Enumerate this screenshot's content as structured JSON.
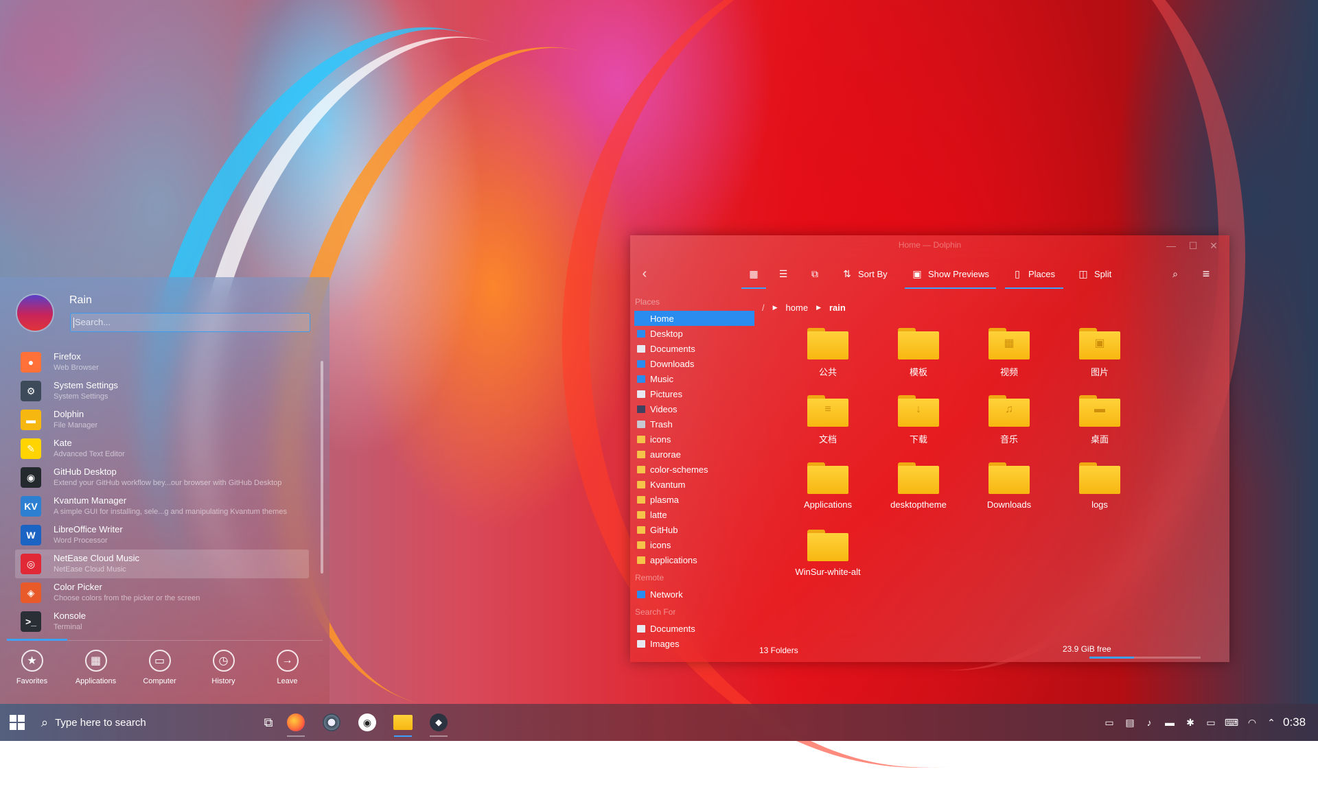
{
  "start_menu": {
    "username": "Rain",
    "search_placeholder": "Search...",
    "apps": [
      {
        "name": "Firefox",
        "desc": "Web Browser",
        "icon": "firefox-icon",
        "color": "#ff7139"
      },
      {
        "name": "System Settings",
        "desc": "System Settings",
        "icon": "settings-icon",
        "color": "#3c4a5a"
      },
      {
        "name": "Dolphin",
        "desc": "File Manager",
        "icon": "folder-icon",
        "color": "#f7b711"
      },
      {
        "name": "Kate",
        "desc": "Advanced Text Editor",
        "icon": "kate-icon",
        "color": "#ffd400"
      },
      {
        "name": "GitHub Desktop",
        "desc": "Extend your GitHub workflow bey...our browser with GitHub Desktop",
        "icon": "github-icon",
        "color": "#24292e"
      },
      {
        "name": "Kvantum Manager",
        "desc": "A simple GUI for installing, sele...g and manipulating Kvantum themes",
        "icon": "kvantum-icon",
        "color": "#2d7fd1"
      },
      {
        "name": "LibreOffice Writer",
        "desc": "Word Processor",
        "icon": "writer-icon",
        "color": "#1b64c4"
      },
      {
        "name": "NetEase Cloud Music",
        "desc": "NetEase Cloud Music",
        "icon": "netease-music-icon",
        "color": "#e02836"
      },
      {
        "name": "Color Picker",
        "desc": "Choose colors from the picker or the screen",
        "icon": "color-picker-icon",
        "color": "#e85a2a"
      },
      {
        "name": "Konsole",
        "desc": "Terminal",
        "icon": "terminal-icon",
        "color": "#2a2f36"
      }
    ],
    "tabs": [
      {
        "label": "Favorites",
        "glyph": "★"
      },
      {
        "label": "Applications",
        "glyph": "▦"
      },
      {
        "label": "Computer",
        "glyph": "▭"
      },
      {
        "label": "History",
        "glyph": "◷"
      },
      {
        "label": "Leave",
        "glyph": "→"
      }
    ]
  },
  "dolphin": {
    "title": "Home — Dolphin",
    "toolbar": {
      "sort_by": "Sort By",
      "show_previews": "Show Previews",
      "places": "Places",
      "split": "Split"
    },
    "places_heading": "Places",
    "places": [
      {
        "label": "Home",
        "color": "#2a8cef",
        "selected": true
      },
      {
        "label": "Desktop",
        "color": "#2a8cef"
      },
      {
        "label": "Documents",
        "color": "#e8e8f0"
      },
      {
        "label": "Downloads",
        "color": "#2a8cef"
      },
      {
        "label": "Music",
        "color": "#2a8cef"
      },
      {
        "label": "Pictures",
        "color": "#e8e8f0"
      },
      {
        "label": "Videos",
        "color": "#404060"
      },
      {
        "label": "Trash",
        "color": "#c8c8d0"
      },
      {
        "label": "icons",
        "color": "#f6c34a"
      },
      {
        "label": "aurorae",
        "color": "#f6c34a"
      },
      {
        "label": "color-schemes",
        "color": "#f6c34a"
      },
      {
        "label": "Kvantum",
        "color": "#f6c34a"
      },
      {
        "label": "plasma",
        "color": "#f6c34a"
      },
      {
        "label": "latte",
        "color": "#f6c34a"
      },
      {
        "label": "GitHub",
        "color": "#f6c34a"
      },
      {
        "label": "icons",
        "color": "#f6c34a"
      },
      {
        "label": "applications",
        "color": "#f6c34a"
      }
    ],
    "remote_heading": "Remote",
    "remote": [
      {
        "label": "Network",
        "color": "#2a8cef"
      }
    ],
    "search_heading": "Search For",
    "search_for": [
      {
        "label": "Documents",
        "color": "#e8e8f0"
      },
      {
        "label": "Images",
        "color": "#e8e8f0"
      }
    ],
    "breadcrumb": [
      "/",
      "home",
      "rain"
    ],
    "files": [
      {
        "name": "公共",
        "emblem": ""
      },
      {
        "name": "模板",
        "emblem": ""
      },
      {
        "name": "视频",
        "emblem": "▦"
      },
      {
        "name": "图片",
        "emblem": "▣"
      },
      {
        "name": "文档",
        "emblem": "≡"
      },
      {
        "name": "下载",
        "emblem": "↓"
      },
      {
        "name": "音乐",
        "emblem": "♫"
      },
      {
        "name": "桌面",
        "emblem": "▬"
      },
      {
        "name": "Applications",
        "emblem": ""
      },
      {
        "name": "desktoptheme",
        "emblem": ""
      },
      {
        "name": "Downloads",
        "emblem": ""
      },
      {
        "name": "logs",
        "emblem": ""
      },
      {
        "name": "WinSur-white-alt",
        "emblem": ""
      }
    ],
    "status_left": "13 Folders",
    "status_right": "23.9 GiB free",
    "disk_used_fraction": 0.4
  },
  "taskbar": {
    "search_placeholder": "Type here to search",
    "clock": "0:38",
    "apps": [
      "task-view-icon",
      "firefox-icon",
      "settings-icon",
      "github-icon",
      "folder-icon",
      "linux-tux-icon"
    ]
  },
  "colors": {
    "accent": "#3da2ff",
    "selection": "#2a8cef",
    "folder": "#f7b711"
  }
}
